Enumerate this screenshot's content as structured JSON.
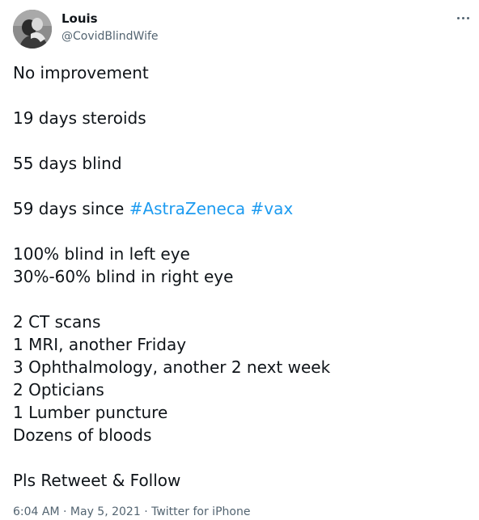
{
  "author": {
    "name": "Louis",
    "handle": "@CovidBlindWife",
    "avatar_icon": "profile-photo"
  },
  "more_icon": "more-options-icon",
  "tweet": {
    "line1": "No improvement",
    "line2": "19 days steroids",
    "line3": "55 days blind",
    "line4_prefix": "59 days since ",
    "hashtag1": "#AstraZeneca",
    "hashtag2": "#vax",
    "line5": "100% blind in left eye",
    "line6": "30%-60% blind in right eye",
    "line7": "2 CT scans",
    "line8": "1 MRI, another Friday",
    "line9": "3 Ophthalmology, another 2 next week",
    "line10": "2 Opticians",
    "line11": "1 Lumber puncture",
    "line12": "Dozens of bloods",
    "line13": "Pls Retweet & Follow"
  },
  "meta": {
    "time": "6:04 AM",
    "separator": " · ",
    "date": "May 5, 2021",
    "source": "Twitter for iPhone"
  },
  "colors": {
    "text": "#0f1419",
    "secondary": "#536471",
    "link": "#1d9bf0"
  }
}
